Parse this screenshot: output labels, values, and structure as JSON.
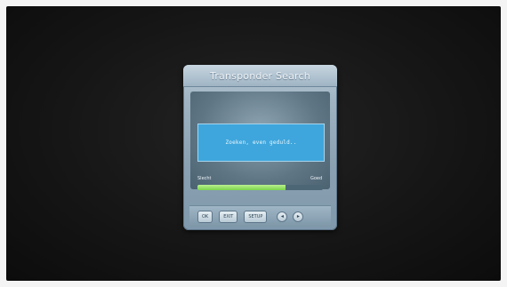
{
  "dialog": {
    "title": "Transponder Search",
    "message": "Zoeken, even geduld..",
    "signal": {
      "label_low": "Slecht",
      "label_high": "Goed",
      "level": 0.7,
      "fill_color": "#8ddc5a"
    },
    "buttons": {
      "ok": "OK",
      "exit": "EXIT",
      "setup": "SETUP",
      "left_icon": "arrow-left-icon",
      "right_icon": "arrow-right-icon"
    }
  }
}
